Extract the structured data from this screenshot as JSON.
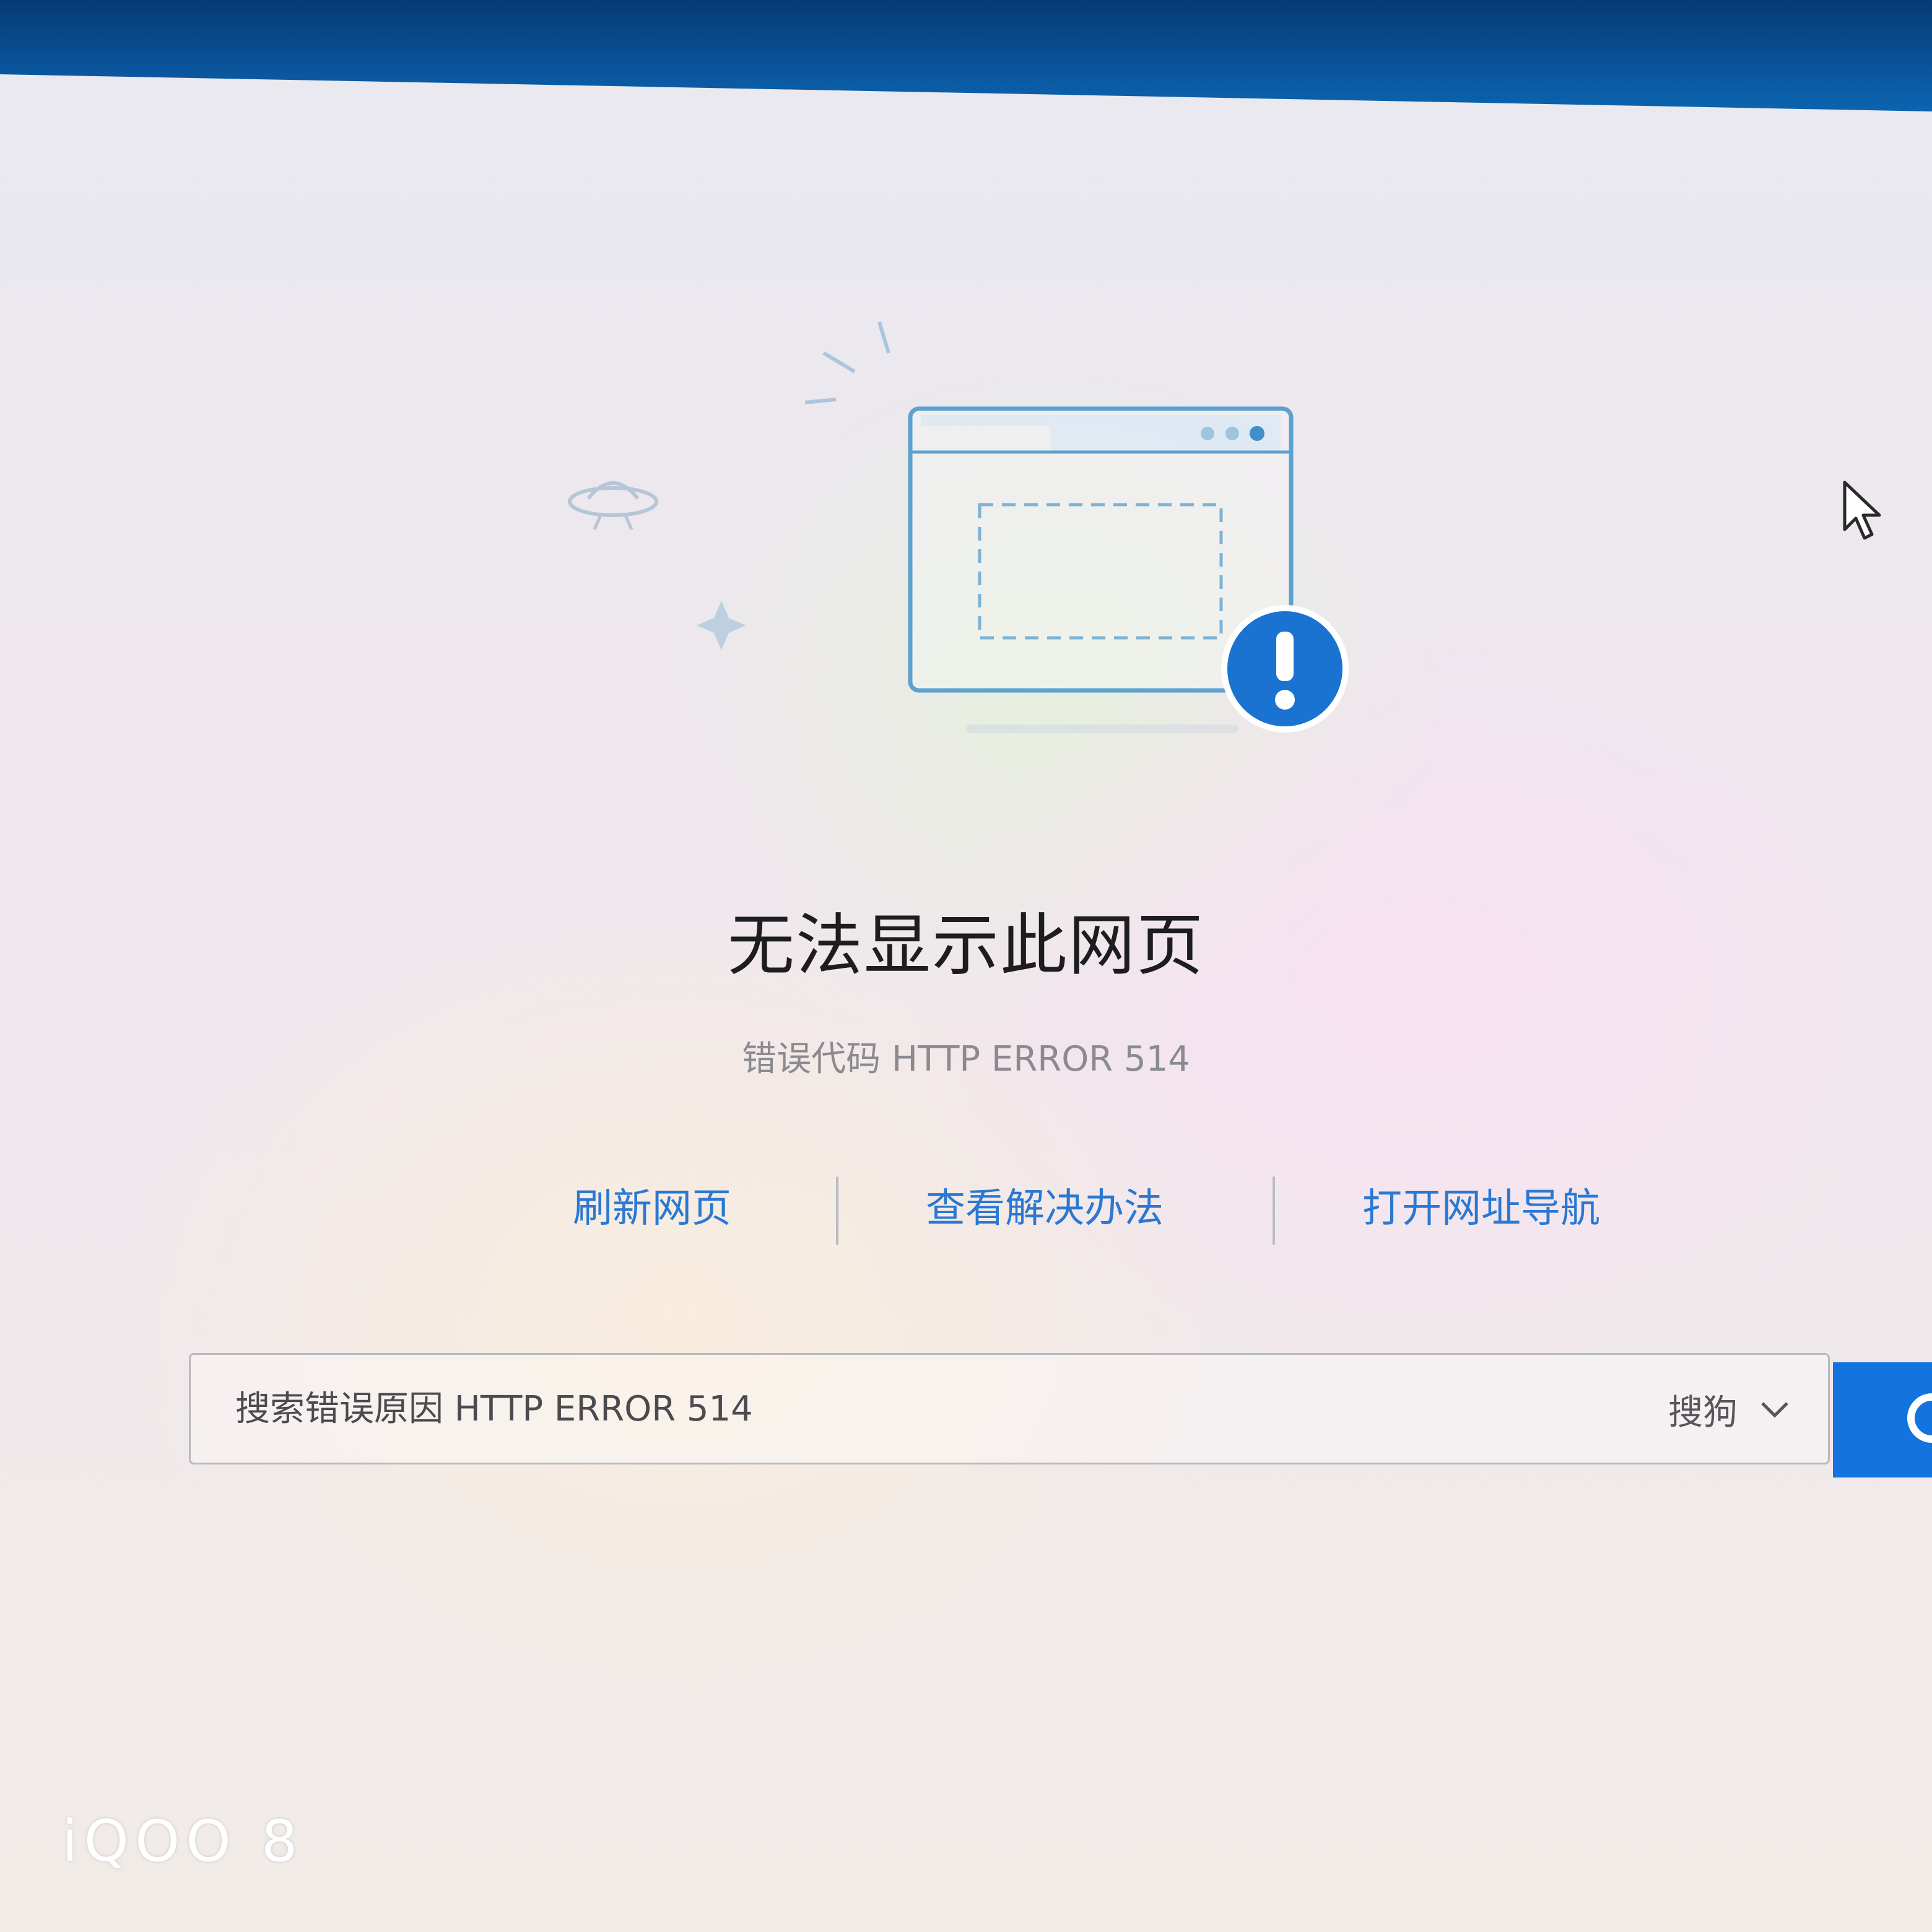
{
  "error_page": {
    "title": "无法显示此网页",
    "error_code_text": "错误代码 HTTP ERROR 514",
    "actions": [
      {
        "label": "刷新网页"
      },
      {
        "label": "查看解决办法"
      },
      {
        "label": "打开网址导航"
      }
    ],
    "search": {
      "placeholder": "搜索错误原因 HTTP ERROR 514",
      "engine": "搜狗"
    }
  },
  "photo_watermark": "iQOO 8",
  "colors": {
    "accent_blue": "#1373df",
    "link_blue": "#2a78d3",
    "title_text": "#1d1d1f"
  },
  "icons": [
    "browser-window-icon",
    "warning-badge-icon",
    "ufo-icon",
    "planet-icon",
    "sparkle-icon",
    "chevron-down-icon",
    "search-icon",
    "mouse-cursor-icon"
  ]
}
